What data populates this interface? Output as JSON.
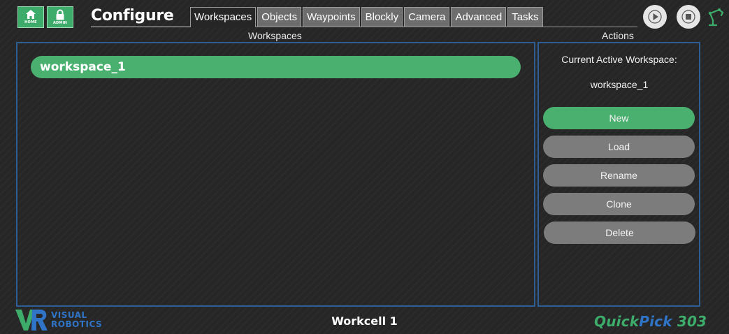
{
  "header": {
    "home_label": "HOME",
    "admin_label": "ADMIN",
    "title": "Configure",
    "tabs": [
      {
        "label": "Workspaces",
        "active": true
      },
      {
        "label": "Objects",
        "active": false
      },
      {
        "label": "Waypoints",
        "active": false
      },
      {
        "label": "Blockly",
        "active": false
      },
      {
        "label": "Camera",
        "active": false
      },
      {
        "label": "Advanced",
        "active": false
      },
      {
        "label": "Tasks",
        "active": false
      }
    ],
    "icons": [
      "home-icon",
      "lock-icon",
      "play-icon",
      "stop-icon",
      "robot-arm-icon"
    ]
  },
  "workspaces_panel": {
    "label": "Workspaces",
    "items": [
      "workspace_1"
    ]
  },
  "actions_panel": {
    "label": "Actions",
    "current_label": "Current Active Workspace:",
    "current_value": "workspace_1",
    "buttons": [
      "New",
      "Load",
      "Rename",
      "Clone",
      "Delete"
    ]
  },
  "footer": {
    "logo_line1": "VISUAL",
    "logo_line2": "ROBOTICS",
    "workcell": "Workcell 1",
    "brand_quick": "Quick",
    "brand_pick": "Pick",
    "brand_num": "303"
  },
  "colors": {
    "accent_green": "#4ab06f",
    "panel_border": "#2e5f94",
    "button_gray": "#7c7c7c",
    "brand_blue": "#2f74c6"
  }
}
